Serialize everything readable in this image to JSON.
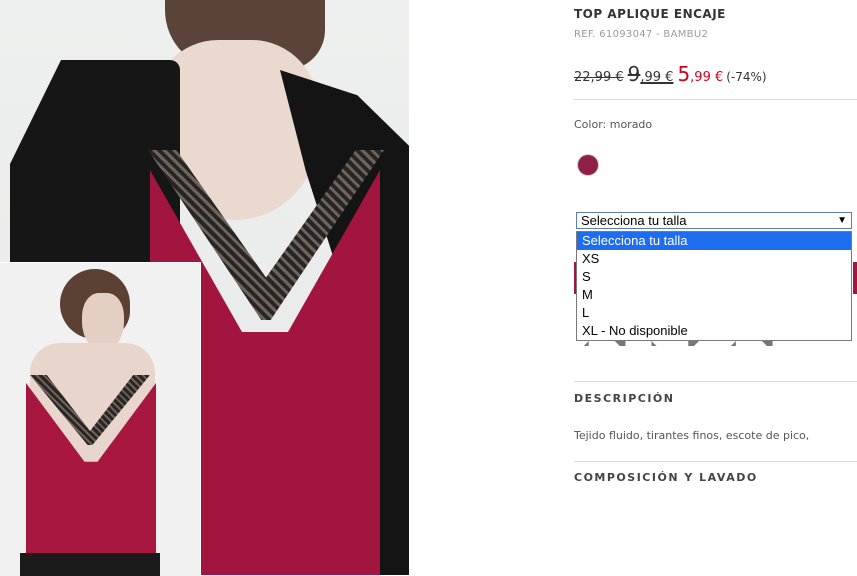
{
  "product": {
    "title": "TOP APLIQUE ENCAJE",
    "ref": "REF. 61093047 - BAMBU2",
    "price_original": "22,99 €",
    "price_previous_int": "9",
    "price_previous_dec": ",99 €",
    "price_sale_int": "5",
    "price_sale_dec": ",99 €",
    "discount": "(-74%)",
    "color_label": "Color: morado",
    "swatch_color": "#8e1f47",
    "sale_color": "#d0021b"
  },
  "size_select": {
    "selected": "Selecciona tu talla",
    "arrow": "▼",
    "options": [
      "Selecciona tu talla",
      "XS",
      "S",
      "M",
      "L",
      "XL - No disponible"
    ]
  },
  "sections": {
    "description_title": "DESCRIPCIÓN",
    "description_text": "Tejido fluido, tirantes finos, escote de pico,",
    "composition_title": "COMPOSICIÓN Y LAVADO"
  }
}
